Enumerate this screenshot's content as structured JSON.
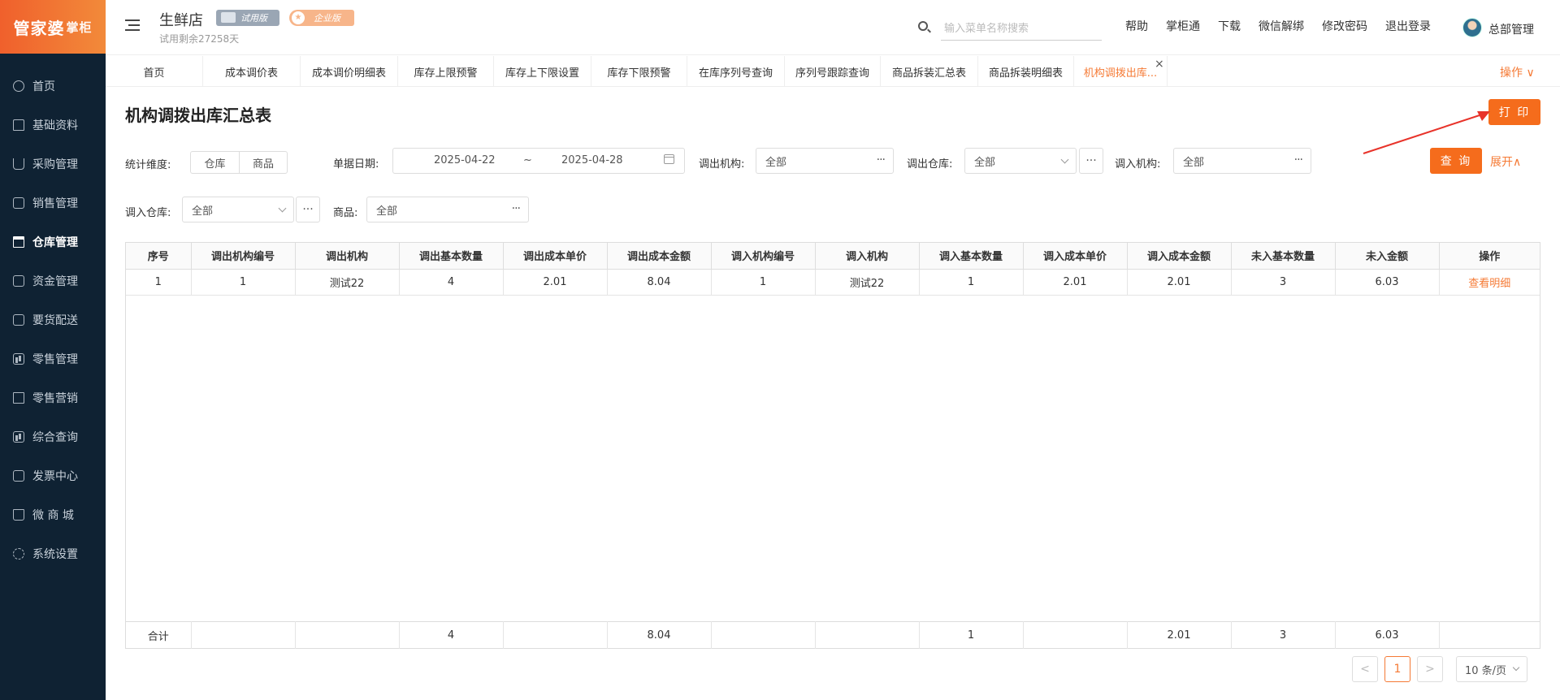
{
  "app": {
    "logo_main": "管家婆",
    "logo_sub": "掌柜",
    "store_name": "生鲜店",
    "badge_trial": "试用版",
    "badge_enterprise": "企业版",
    "trial_days": "试用剩余27258天"
  },
  "sidebar": {
    "items": [
      {
        "label": "首页",
        "icon": "globe-icon"
      },
      {
        "label": "基础资料",
        "icon": "house-icon"
      },
      {
        "label": "采购管理",
        "icon": "cart-icon"
      },
      {
        "label": "销售管理",
        "icon": "sales-icon"
      },
      {
        "label": "仓库管理",
        "icon": "bank-icon"
      },
      {
        "label": "资金管理",
        "icon": "finance-icon"
      },
      {
        "label": "要货配送",
        "icon": "delivery-icon"
      },
      {
        "label": "零售管理",
        "icon": "bar-chart-icon"
      },
      {
        "label": "零售营销",
        "icon": "gift-icon"
      },
      {
        "label": "综合查询",
        "icon": "report-icon"
      },
      {
        "label": "发票中心",
        "icon": "invoice-icon"
      },
      {
        "label": "微 商 城",
        "icon": "bag-icon"
      },
      {
        "label": "系统设置",
        "icon": "gear-icon"
      }
    ],
    "active_index": 4
  },
  "header": {
    "search_placeholder": "输入菜单名称搜索",
    "links": [
      "帮助",
      "掌柜通",
      "下载",
      "微信解绑",
      "修改密码",
      "退出登录"
    ],
    "user_name": "总部管理"
  },
  "tabs": {
    "items": [
      "首页",
      "成本调价表",
      "成本调价明细表",
      "库存上限预警",
      "库存上下限设置",
      "库存下限预警",
      "在库序列号查询",
      "序列号跟踪查询",
      "商品拆装汇总表",
      "商品拆装明细表",
      "机构调拨出库..."
    ],
    "active_index": 10,
    "close_icon": "×",
    "operations": "操作 ∨"
  },
  "page": {
    "title": "机构调拨出库汇总表",
    "print_button": "打 印",
    "query_button": "查 询",
    "expand_label": "展开∧"
  },
  "filters": {
    "dimension_label": "统计维度:",
    "dimension_options": [
      "仓库",
      "商品"
    ],
    "date_label": "单据日期:",
    "date_start": "2025-04-22",
    "date_sep": "~",
    "date_end": "2025-04-28",
    "out_org_label": "调出机构:",
    "out_org_value": "全部",
    "out_wh_label": "调出仓库:",
    "out_wh_value": "全部",
    "in_org_label": "调入机构:",
    "in_org_value": "全部",
    "in_wh_label": "调入仓库:",
    "in_wh_value": "全部",
    "product_label": "商品:",
    "product_value": "全部",
    "dots": "···"
  },
  "table": {
    "columns": [
      "序号",
      "调出机构编号",
      "调出机构",
      "调出基本数量",
      "调出成本单价",
      "调出成本金额",
      "调入机构编号",
      "调入机构",
      "调入基本数量",
      "调入成本单价",
      "调入成本金额",
      "未入基本数量",
      "未入金额",
      "操作"
    ],
    "rows": [
      [
        "1",
        "1",
        "测试22",
        "4",
        "2.01",
        "8.04",
        "1",
        "测试22",
        "1",
        "2.01",
        "2.01",
        "3",
        "6.03",
        "查看明细"
      ]
    ],
    "totals": [
      "合计",
      "",
      "",
      "4",
      "",
      "8.04",
      "",
      "",
      "1",
      "",
      "2.01",
      "3",
      "6.03",
      ""
    ]
  },
  "pagination": {
    "prev": "<",
    "current": "1",
    "next": ">",
    "page_size": "10 条/页"
  },
  "colors": {
    "accent": "#f56c1c",
    "sidebar_bg": "#0f2233"
  }
}
